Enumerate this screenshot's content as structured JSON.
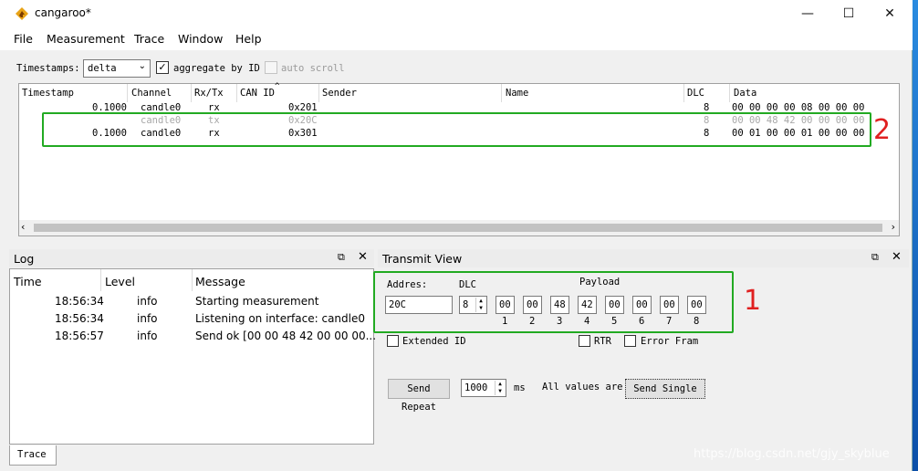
{
  "window": {
    "title": "cangaroo*",
    "minimize_glyph": "—",
    "maximize_glyph": "☐",
    "close_glyph": "✕"
  },
  "menu": [
    "File",
    "Measurement",
    "Trace",
    "Window",
    "Help"
  ],
  "toolbar": {
    "timestamps_label": "Timestamps:",
    "timestamps_value": "delta",
    "aggregate_label": "aggregate by ID",
    "aggregate_checked": true,
    "auto_scroll_label": "auto scroll",
    "auto_scroll_checked": false
  },
  "trace": {
    "columns": [
      "Timestamp",
      "Channel",
      "Rx/Tx",
      "CAN ID",
      "Sender",
      "Name",
      "DLC",
      "Data"
    ],
    "rows": [
      {
        "timestamp": "0.1000",
        "channel": "candle0",
        "rxtx": "rx",
        "can_id": "0x201",
        "dlc": "8",
        "data": "00 00 00 00 08 00 00 00",
        "dim": false
      },
      {
        "timestamp": "",
        "channel": "candle0",
        "rxtx": "tx",
        "can_id": "0x20C",
        "dlc": "8",
        "data": "00 00 48 42 00 00 00 00",
        "dim": true
      },
      {
        "timestamp": "0.1000",
        "channel": "candle0",
        "rxtx": "rx",
        "can_id": "0x301",
        "dlc": "8",
        "data": "00 01 00 00 01 00 00 00",
        "dim": false
      }
    ]
  },
  "log": {
    "title": "Log",
    "columns": [
      "Time",
      "Level",
      "Message"
    ],
    "rows": [
      {
        "time": "18:56:34",
        "level": "info",
        "message": "Starting measurement"
      },
      {
        "time": "18:56:34",
        "level": "info",
        "message": "Listening on interface: candle0"
      },
      {
        "time": "18:56:57",
        "level": "info",
        "message": "Send ok [00 00 48 42 00 00 00..."
      }
    ],
    "tab_label": "Trace"
  },
  "transmit": {
    "title": "Transmit View",
    "address_label": "Addres:",
    "address_value": "20C",
    "dlc_label": "DLC",
    "dlc_value": "8",
    "payload_label": "Payload",
    "payload_values": [
      "00",
      "00",
      "48",
      "42",
      "00",
      "00",
      "00",
      "00"
    ],
    "payload_indices": [
      "1",
      "2",
      "3",
      "4",
      "5",
      "6",
      "7",
      "8"
    ],
    "extended_id_label": "Extended ID",
    "rtr_label": "RTR",
    "error_frame_label": "Error Fram",
    "send_repeat_label": "Send Repeat",
    "repeat_interval": "1000",
    "ms_label": "ms",
    "all_values_label": "All values are",
    "send_single_label": "Send Single"
  },
  "annotations": {
    "box1": "1",
    "box2": "2"
  },
  "watermark": "https://blog.csdn.net/gjy_skyblue",
  "colors": {
    "annotation_box": "#22aa22",
    "annotation_number": "#e02020",
    "desktop": "#1a6fc2"
  }
}
